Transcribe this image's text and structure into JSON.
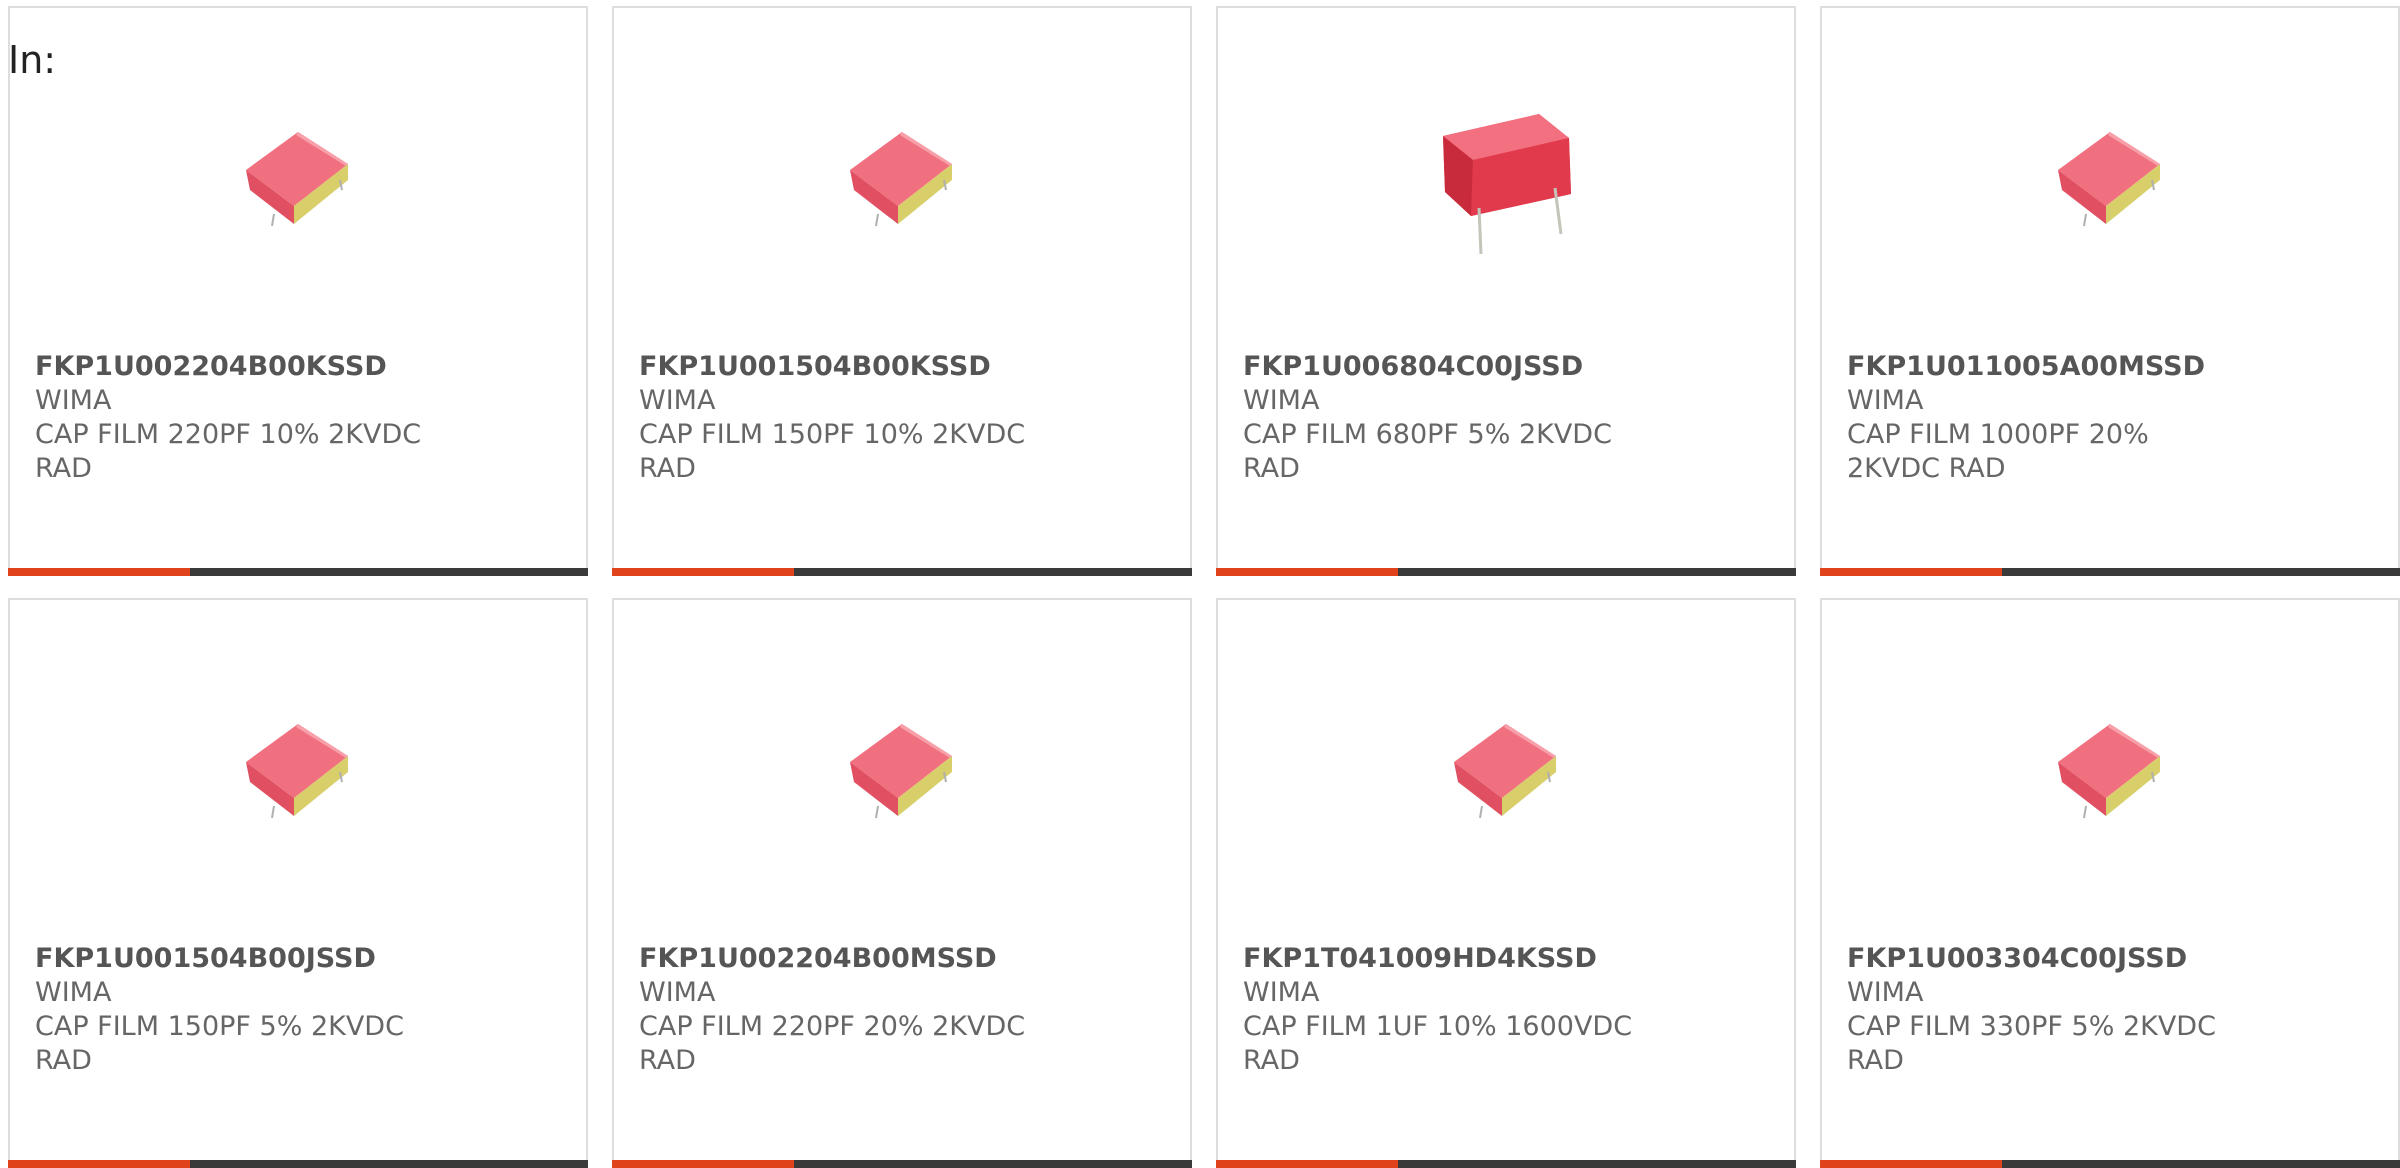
{
  "heading": "In:",
  "colors": {
    "accent": "#e0431c",
    "bar": "#3a3a3a",
    "capacitor_body": "#ee6272",
    "capacitor_lead": "#d8cf6a"
  },
  "products": [
    {
      "part_number": "FKP1U002204B00KSSD",
      "manufacturer": "WIMA",
      "description": "CAP FILM 220PF 10% 2KVDC RAD",
      "icon": "capacitor-icon"
    },
    {
      "part_number": "FKP1U001504B00KSSD",
      "manufacturer": "WIMA",
      "description": "CAP FILM 150PF 10% 2KVDC RAD",
      "icon": "capacitor-icon"
    },
    {
      "part_number": "FKP1U006804C00JSSD",
      "manufacturer": "WIMA",
      "description": "CAP FILM 680PF 5% 2KVDC RAD",
      "icon": "capacitor-leads-icon"
    },
    {
      "part_number": "FKP1U011005A00MSSD",
      "manufacturer": "WIMA",
      "description": "CAP FILM 1000PF 20% 2KVDC RAD",
      "icon": "capacitor-icon"
    },
    {
      "part_number": "FKP1U001504B00JSSD",
      "manufacturer": "WIMA",
      "description": "CAP FILM 150PF 5% 2KVDC RAD",
      "icon": "capacitor-icon"
    },
    {
      "part_number": "FKP1U002204B00MSSD",
      "manufacturer": "WIMA",
      "description": "CAP FILM 220PF 20% 2KVDC RAD",
      "icon": "capacitor-icon"
    },
    {
      "part_number": "FKP1T041009HD4KSSD",
      "manufacturer": "WIMA",
      "description": "CAP FILM 1UF 10% 1600VDC RAD",
      "icon": "capacitor-icon"
    },
    {
      "part_number": "FKP1U003304C00JSSD",
      "manufacturer": "WIMA",
      "description": "CAP FILM 330PF 5% 2KVDC RAD",
      "icon": "capacitor-icon"
    }
  ]
}
